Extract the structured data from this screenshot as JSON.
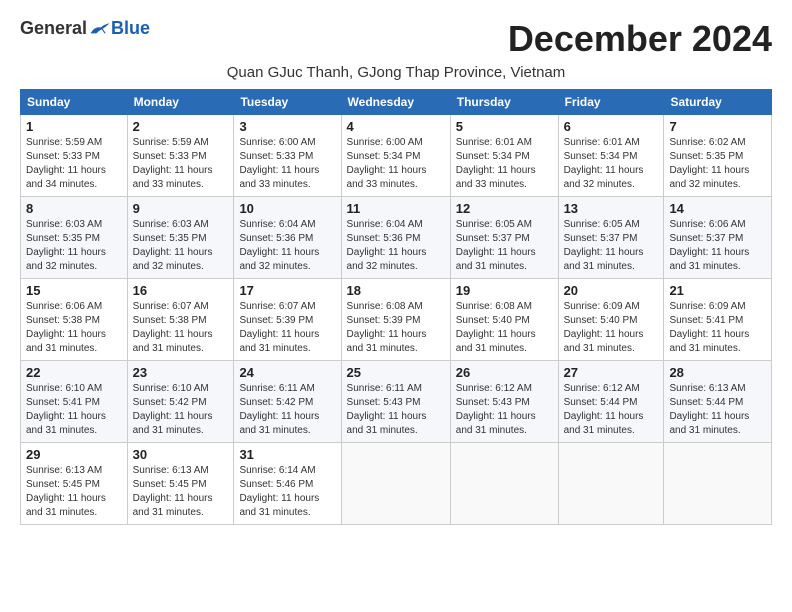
{
  "logo": {
    "general": "General",
    "blue": "Blue"
  },
  "title": "December 2024",
  "subtitle": "Quan GJuc Thanh, GJong Thap Province, Vietnam",
  "days_header": [
    "Sunday",
    "Monday",
    "Tuesday",
    "Wednesday",
    "Thursday",
    "Friday",
    "Saturday"
  ],
  "weeks": [
    [
      {
        "day": "1",
        "sunrise": "5:59 AM",
        "sunset": "5:33 PM",
        "daylight": "11 hours and 34 minutes."
      },
      {
        "day": "2",
        "sunrise": "5:59 AM",
        "sunset": "5:33 PM",
        "daylight": "11 hours and 33 minutes."
      },
      {
        "day": "3",
        "sunrise": "6:00 AM",
        "sunset": "5:33 PM",
        "daylight": "11 hours and 33 minutes."
      },
      {
        "day": "4",
        "sunrise": "6:00 AM",
        "sunset": "5:34 PM",
        "daylight": "11 hours and 33 minutes."
      },
      {
        "day": "5",
        "sunrise": "6:01 AM",
        "sunset": "5:34 PM",
        "daylight": "11 hours and 33 minutes."
      },
      {
        "day": "6",
        "sunrise": "6:01 AM",
        "sunset": "5:34 PM",
        "daylight": "11 hours and 32 minutes."
      },
      {
        "day": "7",
        "sunrise": "6:02 AM",
        "sunset": "5:35 PM",
        "daylight": "11 hours and 32 minutes."
      }
    ],
    [
      {
        "day": "8",
        "sunrise": "6:03 AM",
        "sunset": "5:35 PM",
        "daylight": "11 hours and 32 minutes."
      },
      {
        "day": "9",
        "sunrise": "6:03 AM",
        "sunset": "5:35 PM",
        "daylight": "11 hours and 32 minutes."
      },
      {
        "day": "10",
        "sunrise": "6:04 AM",
        "sunset": "5:36 PM",
        "daylight": "11 hours and 32 minutes."
      },
      {
        "day": "11",
        "sunrise": "6:04 AM",
        "sunset": "5:36 PM",
        "daylight": "11 hours and 32 minutes."
      },
      {
        "day": "12",
        "sunrise": "6:05 AM",
        "sunset": "5:37 PM",
        "daylight": "11 hours and 31 minutes."
      },
      {
        "day": "13",
        "sunrise": "6:05 AM",
        "sunset": "5:37 PM",
        "daylight": "11 hours and 31 minutes."
      },
      {
        "day": "14",
        "sunrise": "6:06 AM",
        "sunset": "5:37 PM",
        "daylight": "11 hours and 31 minutes."
      }
    ],
    [
      {
        "day": "15",
        "sunrise": "6:06 AM",
        "sunset": "5:38 PM",
        "daylight": "11 hours and 31 minutes."
      },
      {
        "day": "16",
        "sunrise": "6:07 AM",
        "sunset": "5:38 PM",
        "daylight": "11 hours and 31 minutes."
      },
      {
        "day": "17",
        "sunrise": "6:07 AM",
        "sunset": "5:39 PM",
        "daylight": "11 hours and 31 minutes."
      },
      {
        "day": "18",
        "sunrise": "6:08 AM",
        "sunset": "5:39 PM",
        "daylight": "11 hours and 31 minutes."
      },
      {
        "day": "19",
        "sunrise": "6:08 AM",
        "sunset": "5:40 PM",
        "daylight": "11 hours and 31 minutes."
      },
      {
        "day": "20",
        "sunrise": "6:09 AM",
        "sunset": "5:40 PM",
        "daylight": "11 hours and 31 minutes."
      },
      {
        "day": "21",
        "sunrise": "6:09 AM",
        "sunset": "5:41 PM",
        "daylight": "11 hours and 31 minutes."
      }
    ],
    [
      {
        "day": "22",
        "sunrise": "6:10 AM",
        "sunset": "5:41 PM",
        "daylight": "11 hours and 31 minutes."
      },
      {
        "day": "23",
        "sunrise": "6:10 AM",
        "sunset": "5:42 PM",
        "daylight": "11 hours and 31 minutes."
      },
      {
        "day": "24",
        "sunrise": "6:11 AM",
        "sunset": "5:42 PM",
        "daylight": "11 hours and 31 minutes."
      },
      {
        "day": "25",
        "sunrise": "6:11 AM",
        "sunset": "5:43 PM",
        "daylight": "11 hours and 31 minutes."
      },
      {
        "day": "26",
        "sunrise": "6:12 AM",
        "sunset": "5:43 PM",
        "daylight": "11 hours and 31 minutes."
      },
      {
        "day": "27",
        "sunrise": "6:12 AM",
        "sunset": "5:44 PM",
        "daylight": "11 hours and 31 minutes."
      },
      {
        "day": "28",
        "sunrise": "6:13 AM",
        "sunset": "5:44 PM",
        "daylight": "11 hours and 31 minutes."
      }
    ],
    [
      {
        "day": "29",
        "sunrise": "6:13 AM",
        "sunset": "5:45 PM",
        "daylight": "11 hours and 31 minutes."
      },
      {
        "day": "30",
        "sunrise": "6:13 AM",
        "sunset": "5:45 PM",
        "daylight": "11 hours and 31 minutes."
      },
      {
        "day": "31",
        "sunrise": "6:14 AM",
        "sunset": "5:46 PM",
        "daylight": "11 hours and 31 minutes."
      },
      null,
      null,
      null,
      null
    ]
  ]
}
